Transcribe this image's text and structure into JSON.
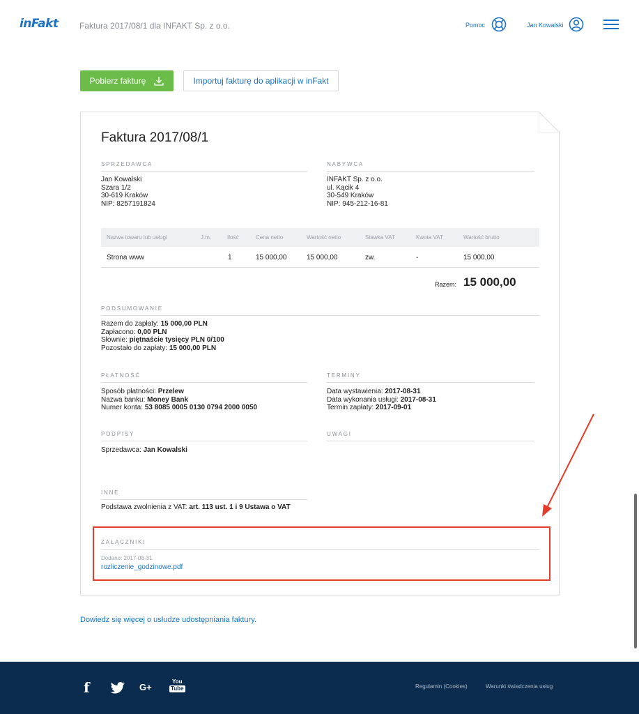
{
  "header": {
    "logo": "inFakt",
    "doc_title": "Faktura 2017/08/1 dla INFAKT Sp. z o.o.",
    "help_label": "Pomoc",
    "help_icon": "lifebuoy-icon",
    "user_label": "Jan Kowalski",
    "user_icon": "user-icon",
    "menu_icon": "hamburger-menu-icon"
  },
  "actions": {
    "download_label": "Pobierz fakturę",
    "download_icon": "download-icon",
    "import_label": "Importuj fakturę do aplikacji w inFakt"
  },
  "invoice": {
    "title": "Faktura 2017/08/1",
    "seller": {
      "label": "SPRZEDAWCA",
      "lines": [
        "Jan Kowalski",
        "Szara 1/2",
        "30-619 Kraków",
        "NIP: 8257191824"
      ]
    },
    "buyer": {
      "label": "NABYWCA",
      "lines": [
        "INFAKT Sp. z o.o.",
        "ul. Kącik 4",
        "30-549 Kraków",
        "NIP: 945-212-16-81"
      ]
    },
    "table": {
      "headers": [
        "Nazwa towaru lub usługi",
        "J.m.",
        "Ilość",
        "Cena netto",
        "Wartość netto",
        "Stawka VAT",
        "Kwota VAT",
        "Wartość brutto"
      ],
      "rows": [
        [
          "Strona www",
          "",
          "1",
          "15 000,00",
          "15 000,00",
          "zw.",
          "-",
          "15 000,00"
        ]
      ]
    },
    "total_label": "Razem:",
    "total_value": "15 000,00",
    "summary": {
      "label": "PODSUMOWANIE",
      "to_pay_label": "Razem do zapłaty: ",
      "to_pay_value": "15 000,00 PLN",
      "paid_label": "Zapłacono: ",
      "paid_value": "0,00 PLN",
      "words_label": "Słownie: ",
      "words_value": "piętnaście tysięcy PLN 0/100",
      "remaining_label": "Pozostało do zapłaty: ",
      "remaining_value": "15 000,00 PLN"
    },
    "payment": {
      "label": "PŁATNOŚĆ",
      "method_label": "Sposób płatności: ",
      "method_value": "Przelew",
      "bank_label": "Nazwa banku: ",
      "bank_value": "Money Bank",
      "account_label": "Numer konta: ",
      "account_value": "53 8085 0005 0130 0794 2000 0050"
    },
    "terms": {
      "label": "TERMINY",
      "issue_label": "Data wystawienia: ",
      "issue_value": "2017-08-31",
      "service_label": "Data wykonania usługi: ",
      "service_value": "2017-08-31",
      "due_label": "Termin zapłaty: ",
      "due_value": "2017-09-01"
    },
    "signatures": {
      "label": "PODPISY",
      "seller_label": "Sprzedawca: ",
      "seller_value": "Jan Kowalski"
    },
    "notes": {
      "label": "UWAGI"
    },
    "other": {
      "label": "INNE",
      "basis_label": "Podstawa zwolnienia z VAT: ",
      "basis_value": "art. 113 ust. 1 i 9 Ustawa o VAT"
    },
    "attachments": {
      "label": "ZAŁĄCZNIKI",
      "added": "Dodano: 2017-08-31",
      "file": "rozliczenie_godzinowe.pdf"
    }
  },
  "learn_more": "Dowiedz się więcej o usłudze udostępniania faktury.",
  "annotation_color": "#e43b2b",
  "footer": {
    "social": [
      "facebook-icon",
      "twitter-icon",
      "google-plus-icon",
      "youtube-icon"
    ],
    "gplus_text": "G+",
    "yt_top": "You",
    "yt_bottom": "Tube",
    "regulamin": "Regulamin (Cookies)",
    "warunki": "Warunki świadczenia usług"
  }
}
